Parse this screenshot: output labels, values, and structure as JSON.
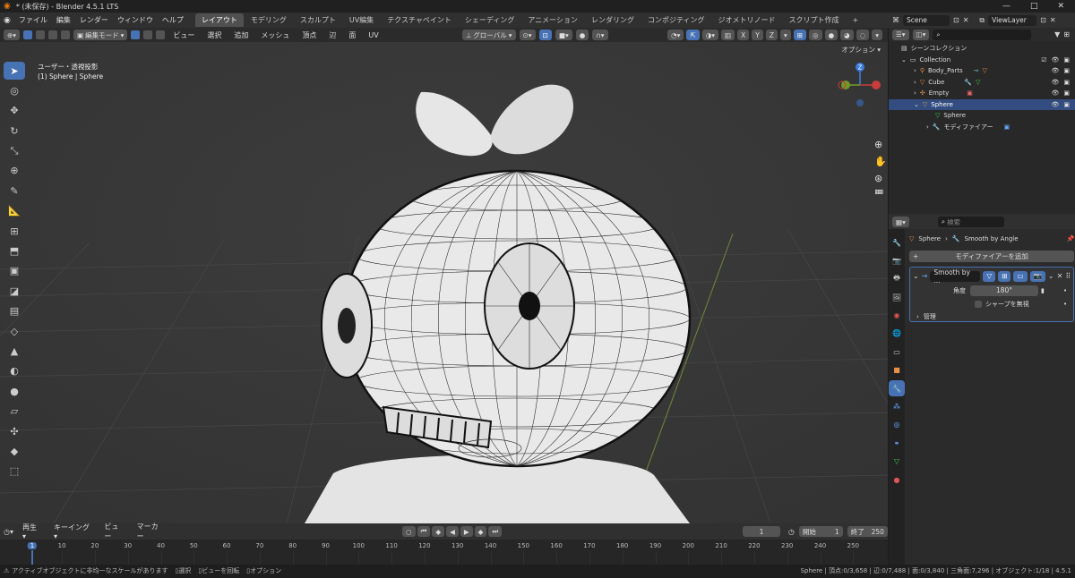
{
  "window": {
    "title": "* (未保存) - Blender 4.5.1 LTS",
    "controls": [
      "—",
      "□",
      "✕"
    ]
  },
  "menu": [
    "ファイル",
    "編集",
    "レンダー",
    "ウィンドウ",
    "ヘルプ"
  ],
  "workspaces": [
    "レイアウト",
    "モデリング",
    "スカルプト",
    "UV編集",
    "テクスチャペイント",
    "シェーディング",
    "アニメーション",
    "レンダリング",
    "コンポジティング",
    "ジオメトリノード",
    "スクリプト作成"
  ],
  "active_workspace": "レイアウト",
  "viewport_header": {
    "mode": "編集モード",
    "menus": [
      "ビュー",
      "選択",
      "追加",
      "メッシュ",
      "頂点",
      "辺",
      "面",
      "UV"
    ],
    "transform": "グローバル",
    "axes": [
      "X",
      "Y",
      "Z"
    ],
    "options": "オプション"
  },
  "overlay_text": {
    "view": "ユーザー・透視投影",
    "object": "(1) Sphere | Sphere"
  },
  "gizmo": {
    "z": "Z",
    "y": "Y",
    "x": "X"
  },
  "outliner": {
    "scene": "Scene",
    "view_layer": "ViewLayer",
    "root": "シーンコレクション",
    "collection": "Collection",
    "items": [
      "Body_Parts",
      "Cube",
      "Empty",
      "Sphere"
    ],
    "sphere_children": [
      "Sphere",
      "モディファイアー"
    ]
  },
  "properties": {
    "search": "検索",
    "breadcrumb": [
      "Sphere",
      "Smooth by Angle"
    ],
    "add_modifier": "モディファイアーを追加",
    "modifier_name": "Smooth by ...",
    "angle_label": "角度",
    "angle_value": "180°",
    "ignore_sharp": "シャープを無視",
    "manage": "管理"
  },
  "timeline": {
    "menus": [
      "再生",
      "キーイング",
      "ビュー",
      "マーカー"
    ],
    "current_frame": "1",
    "start_label": "開始",
    "start": "1",
    "end_label": "終了",
    "end": "250",
    "ticks": [
      "1",
      "10",
      "20",
      "30",
      "40",
      "50",
      "60",
      "70",
      "80",
      "90",
      "100",
      "110",
      "120",
      "130",
      "140",
      "150",
      "160",
      "170",
      "180",
      "190",
      "200",
      "210",
      "220",
      "230",
      "240",
      "250"
    ]
  },
  "status": {
    "warning": "アクティブオブジェクトに非均一なスケールがあります",
    "hints": [
      "選択",
      "ビューを回転",
      "オプション"
    ],
    "stats": "Sphere | 頂点:0/3,658 | 辺:0/7,488 | 面:0/3,840 | 三角面:7,296 | オブジェクト:1/18 | 4.5.1"
  }
}
